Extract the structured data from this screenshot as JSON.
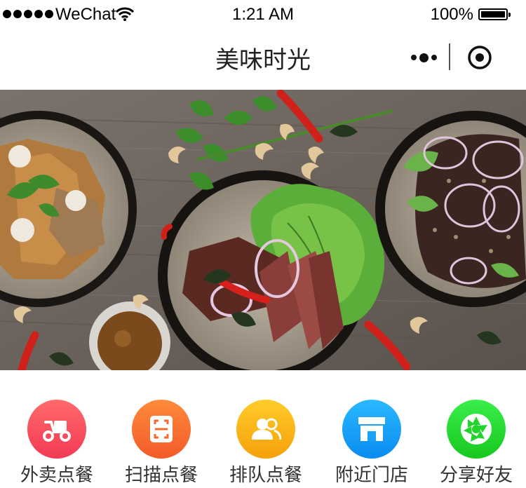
{
  "status_bar": {
    "carrier": "WeChat",
    "time": "1:21 AM",
    "battery": "100%",
    "signal_icon": "signal-dots-icon",
    "wifi_icon": "wifi-icon",
    "battery_icon": "battery-icon"
  },
  "nav": {
    "title": "美味时光",
    "more_icon": "more-dots-icon",
    "close_icon": "target-close-icon"
  },
  "banner": {
    "image": "food-plates-photo"
  },
  "grid": {
    "items": [
      {
        "icon": "scooter-icon",
        "color_top": "#ff6a6a",
        "color_bottom": "#f23a55",
        "label": "外卖点餐"
      },
      {
        "icon": "scan-icon",
        "color_top": "#ff8a3a",
        "color_bottom": "#f25b2a",
        "label": "扫描点餐"
      },
      {
        "icon": "users-icon",
        "color_top": "#ffcc2a",
        "color_bottom": "#f5a00a",
        "label": "排队点餐"
      },
      {
        "icon": "store-icon",
        "color_top": "#2ab8ff",
        "color_bottom": "#0a8cf0",
        "label": "附近门店"
      },
      {
        "icon": "aperture-icon",
        "color_top": "#3aee4a",
        "color_bottom": "#16c81e",
        "label": "分享好友"
      }
    ]
  }
}
